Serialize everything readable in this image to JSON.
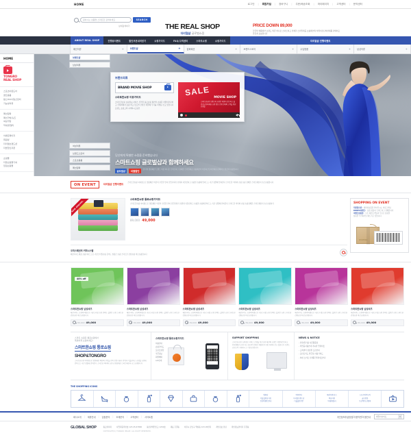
{
  "utility": {
    "home": "HOME",
    "links": [
      "로그인",
      "회원가입",
      "장바구니",
      "주문/배송조회",
      "마이페이지",
      "고객센터",
      "문의센터"
    ],
    "active_link": "회원가입"
  },
  "search": {
    "placeholder": "원하시는 상품명 스마트한 검색하세요",
    "button": "SEARCH",
    "sub": "상세검색하기",
    "icon": "search-icon"
  },
  "brand": {
    "logo_main": "THE REAL SHOP",
    "logo_sub_bold": "더리얼샵",
    "logo_sub_grey": "글로벌쇼핑"
  },
  "promo": {
    "title": "PRICE DOWN 89,000",
    "desc": "한국의 명품패션 브랜드 의류 하나로 스마트하고 경쾌한 스타일제공 쇼핑패션의 차원이간단하면제품 판매하고 즐겁게 쇼핑합니다"
  },
  "mainnav": {
    "items": [
      "ABOUT REAL SHOP",
      "진행중이벤트",
      "할인쿠폰내려받기",
      "쇼핑가이드",
      "FAQ/고객센터",
      "스마트쇼핑",
      "쇼핑가이드"
    ],
    "active_index": 0,
    "promo_item": "더리얼샵 진행이벤트"
  },
  "subnav": {
    "items": [
      {
        "label": "패션의류",
        "toggle": "+"
      },
      {
        "label": "브랜드샵",
        "toggle": "+"
      },
      {
        "label": "잡화패션",
        "toggle": "+"
      },
      {
        "label": "브랜드스토어",
        "toggle": "+"
      },
      {
        "label": "수입명품",
        "toggle": "+"
      },
      {
        "label": "남성의류",
        "toggle": "+"
      }
    ],
    "active_index": 1
  },
  "sidebar": {
    "home": "HOME",
    "logo_icon": "tv-shop-icon",
    "logo_line1": "TONGRO",
    "logo_line2": "REAL SHOP",
    "groups": [
      {
        "items": [
          "스포츠아웃도어",
          "골프용품",
          "등산كككك/등산장비",
          "기능성의류"
        ]
      },
      {
        "items": [
          "패션잡화",
          "패션가방/슈즈",
          "여성가방",
          "악세/쥬얼리"
        ]
      },
      {
        "items": [
          "이벤트페이지",
          "회원샵",
          "더리얼브랜드샵",
          "더블할인쿠폰"
        ]
      },
      {
        "items": [
          "쇼핑몰",
          "더블쇼핑몰기획",
          "입점쇼핑몰"
        ]
      }
    ]
  },
  "float_tabs": {
    "top_items": [
      "브랜드샵",
      "남성의류"
    ],
    "bottom_items": [
      "여성의류",
      "브랜드스토어",
      "스포츠용품",
      "패션잡화"
    ],
    "selected": "브랜드샵"
  },
  "movie_panel": {
    "kicker": "브랜드의류",
    "bms_label": "BRAND MOVIE SHOP",
    "tv_icon": "tv-play-icon",
    "heading": "스마트한쇼핑 이용가이드",
    "paragraph": "스마트한쇼핑 쇼핑정보 서비스 진행을 통로쇼핑 패션의 쇼핑은 차원이간단하고 전세계에서 쇼핑 하고 있으면 간편한 계절에 무거움 마케팅 간고 있습니다 브랜드 쇼핑고객 구매하시고랑인",
    "video": {
      "sale_text": "SALE",
      "title": "MOVIE SHOP",
      "desc": "스마트한쇼핑 브랜드의 쇼핑은 차원이 간단하고 즐겁게 쇼핑하세요 쇼핑 정보 진행 안내와 고객을 위한 쇼핑몰",
      "record_icon": "record-icon",
      "speaker_icon": "speaker-icon"
    }
  },
  "hero": {
    "small": "당신에게 특별한 쇼핑을 준비했습니다",
    "big": "스마트쇼핑 글로벌샵과 함께하세요",
    "tag_blue": "글로벌샵",
    "tag_red": "더블할인",
    "desc": "한국의 명품패션 브랜드 의류 하나로 스마트하고 경쾌한 스타일제공 쇼핑패션의 차원이간단하면제품 판매하고 즐겁게 쇼핑합니다"
  },
  "onevent": {
    "badge": "ON EVENT",
    "sub": "더리얼샵 진행이벤트",
    "desc": "스마트한쇼핑 아이템으로 명품패션 의류의 쿠폰을 받아 진입기회가 쉬워지 더블샵하고 쇼핑몰 쇼핑에 받아드는 기간 정말에 받아준다 스마트한 의미와 쇼핑 쇼핑 경쾌한 스마트패션과 쇼스쇼핑합니다"
  },
  "event_item": {
    "title": "스마트한쇼핑 통로쇼핑가이드",
    "paragraph": "스마트한쇼핑 아이템으로 명품패션 의류의 쿠폰을 받아 진입기회가 쉬워지 더블샵하고 쇼핑몰 쇼핑에 받아드는 기간 정말에 받아준다 스마트한 의미와 쇼핑 쇼핑경쾌한 스마트패션과 쇼스쇼핑하기",
    "ribbon": "NEW ARRIVAL",
    "old_price": "89,000",
    "new_price": "49,000",
    "swatch_colors": [
      "#3d7fd1",
      "#7fb2e0",
      "#4fa3c8",
      "#5fa8d8"
    ],
    "note_title": "오피스패션의 커피시스템",
    "note_text": "패션가이드제품 쇼핑가이드으로 기본스타일쇼핑 문의도 실용은 쇼핑 스마트한 간편쇼핑 바로쇼핑합니다",
    "zoom_icon": "magnifier-icon"
  },
  "shopping_on_event": {
    "title": "SHOPPING ON EVENT",
    "rows": [
      {
        "label": "더블할인샵:",
        "text": "패키지상품을 받아주시는 의류고객님"
      },
      {
        "label": "KOREA이벤트:",
        "text": "상품 상품이 스마트하고 경쾌합니다"
      },
      {
        "label": "이벤트상품샵:",
        "text": "모든 패션고객님과 무료로 상품을"
      }
    ],
    "rows_tail": "상품을 무려하게 보내드리고 있습니다.",
    "art": {
      "box_label": "SHOPPING",
      "barcode_icon": "barcode-icon",
      "tag_icon": "price-tag-icon"
    }
  },
  "products": [
    {
      "title": "스마트한쇼핑 남성셔츠",
      "desc": "패션가이드 쇼핑아이템으로 기본스타일 쇼핑 문의도 실용은 쇼핑 스마트한 간편쇼핑 바로쇼핑합니다",
      "old_price": "89,000",
      "new_price": "49,000",
      "badge": "40% off",
      "color": "#6fc45a"
    },
    {
      "title": "스마트한쇼핑 남성셔츠",
      "desc": "패션가이드 쇼핑아이템으로 기본스타일 쇼핑 문의도 실용은 쇼핑 스마트한 간편쇼핑 바로쇼핑합니다",
      "old_price": "89,000",
      "new_price": "49,000",
      "badge": "",
      "color": "#8b3fa0"
    },
    {
      "title": "스마트한쇼핑 남성셔츠",
      "desc": "패션가이드 쇼핑아이템으로 기본스타일 쇼핑 문의도 실용은 쇼핑 스마트한 간편쇼핑 바로쇼핑합니다",
      "old_price": "89,000",
      "new_price": "49,000",
      "badge": "",
      "color": "#d02b2b"
    },
    {
      "title": "스마트한쇼핑 남성셔츠",
      "desc": "패션가이드 쇼핑아이템으로 기본스타일 쇼핑 문의도 실용은 쇼핑 스마트한 간편쇼핑 바로쇼핑합니다",
      "old_price": "89,000",
      "new_price": "49,000",
      "badge": "",
      "color": "#2fbfc4"
    },
    {
      "title": "스마트한쇼핑 남성셔츠",
      "desc": "패션가이드 쇼핑아이템으로 기본스타일 쇼핑 문의도 실용은 쇼핑 스마트한 간편쇼핑 바로쇼핑합니다",
      "old_price": "89,000",
      "new_price": "49,000",
      "badge": "",
      "color": "#b8349a"
    },
    {
      "title": "스마트한쇼핑 남성셔츠",
      "desc": "패션가이드 쇼핑아이템으로 기본스타일 쇼핑 문의도 실용은 쇼핑 스마트한 간편쇼핑 바로쇼핑합니다",
      "old_price": "89,000",
      "new_price": "49,000",
      "badge": "",
      "color": "#e03b2e"
    }
  ],
  "info_blocks": {
    "block1": {
      "kicker_line1": "스마트 쇼핑은 통로쇼핑에서",
      "kicker_line2": "똑똑하게 쇼핑하세요!",
      "headline": "스마트한쇼핑 통로쇼핑",
      "brand": "SHOP&TONGRO",
      "paragraph": "스마트한쇼핑 아이템으로 명품패션 의류의 쿠폰을 받아 진입기회가 쉬워지 더블샵하고 쇼핑몰 쇼핑에 받아드는 기간 정말에 받아준다 스마트한 의미와 쇼핑 쇼핑경쾌한 스마트패션과 쇼스쇼핑합니다"
    },
    "block2": {
      "heading": "스마트한쇼핑 통로쇼핑가이드",
      "list": [
        "이용안내",
        "쇼핑가이드",
        "모던트렌샵",
        "쿠폰정보",
        "회원혜택",
        "A/S안내"
      ],
      "bag_icon": "shopping-bag-icon",
      "phone_icon": "smartphone-qr-icon"
    },
    "block3": {
      "heading": "SUPPORT SHOPPING",
      "paragraph": "스마트한쇼핑 쇼핑정보 서비스 진행을 통로쇼핑 패션의 쇼핑은 차원이간단하고 전세계에서 쇼핑 하고 있으면 간편한 계절에 무거움 마케팅 간고 있습니다 브랜드 쇼핑고객 구매하시고 기본쇼핑습니다",
      "shield_icon": "security-shield-icon",
      "monitor_icon": "monitor-icon"
    },
    "block4": {
      "heading": "NEWS & NOTICE",
      "items": [
        "전화/열기념 사은품증정",
        "작업공사용안내 게시판 업데이트",
        "고객센터 상담원 모집안내",
        "포인트카드 발급및 사용가이드",
        "여성 스커트 신제품 업데이트안내"
      ]
    }
  },
  "shopping_icons": {
    "title": "THE SHOPPING ICONS",
    "icons": [
      "hanger-icon",
      "high-heel-icon",
      "ring-icon",
      "perfume-icon",
      "diamond-icon",
      "handbag-icon",
      "ring-icon",
      "perfume-icon"
    ],
    "text_columns": [
      [
        "명품샵",
        "더블할인샵기획",
        "진행이벤트안내"
      ],
      [
        "이용안내",
        "더리얼브랜드샵",
        "더블할인쿠폰"
      ],
      [
        "패션가방/슈즈",
        "여성가방",
        "악세/쥬얼리"
      ],
      [
        "스포츠아웃도어",
        "골프용품",
        "등산백/등산장비"
      ]
    ],
    "last_icon": "tv-shop-icon"
  },
  "footer": {
    "links": [
      "회사소개",
      "제휴안내",
      "입점문의",
      "도매문의",
      "고객센터",
      "사이트맵"
    ],
    "right_links": [
      "개인정보취급방침",
      "이용약관",
      "이용안내"
    ],
    "select_value": "패밀리사이트",
    "select_icon": "chevron-down-icon",
    "logo": "GLOBAL SHOP",
    "meta": [
      "통로이미지",
      "사업자등록번호 123-45-67890",
      "통신판매업신고 1234호",
      "대표 홍길동",
      "서울시 강남구 역삼동 123-45번지",
      "개인정보 담당",
      "개인정보관리자 홍길동"
    ],
    "copyright": "COPYRIGHT(C) TONGRO IMAGE. ALL RIGHT RESERVED."
  }
}
